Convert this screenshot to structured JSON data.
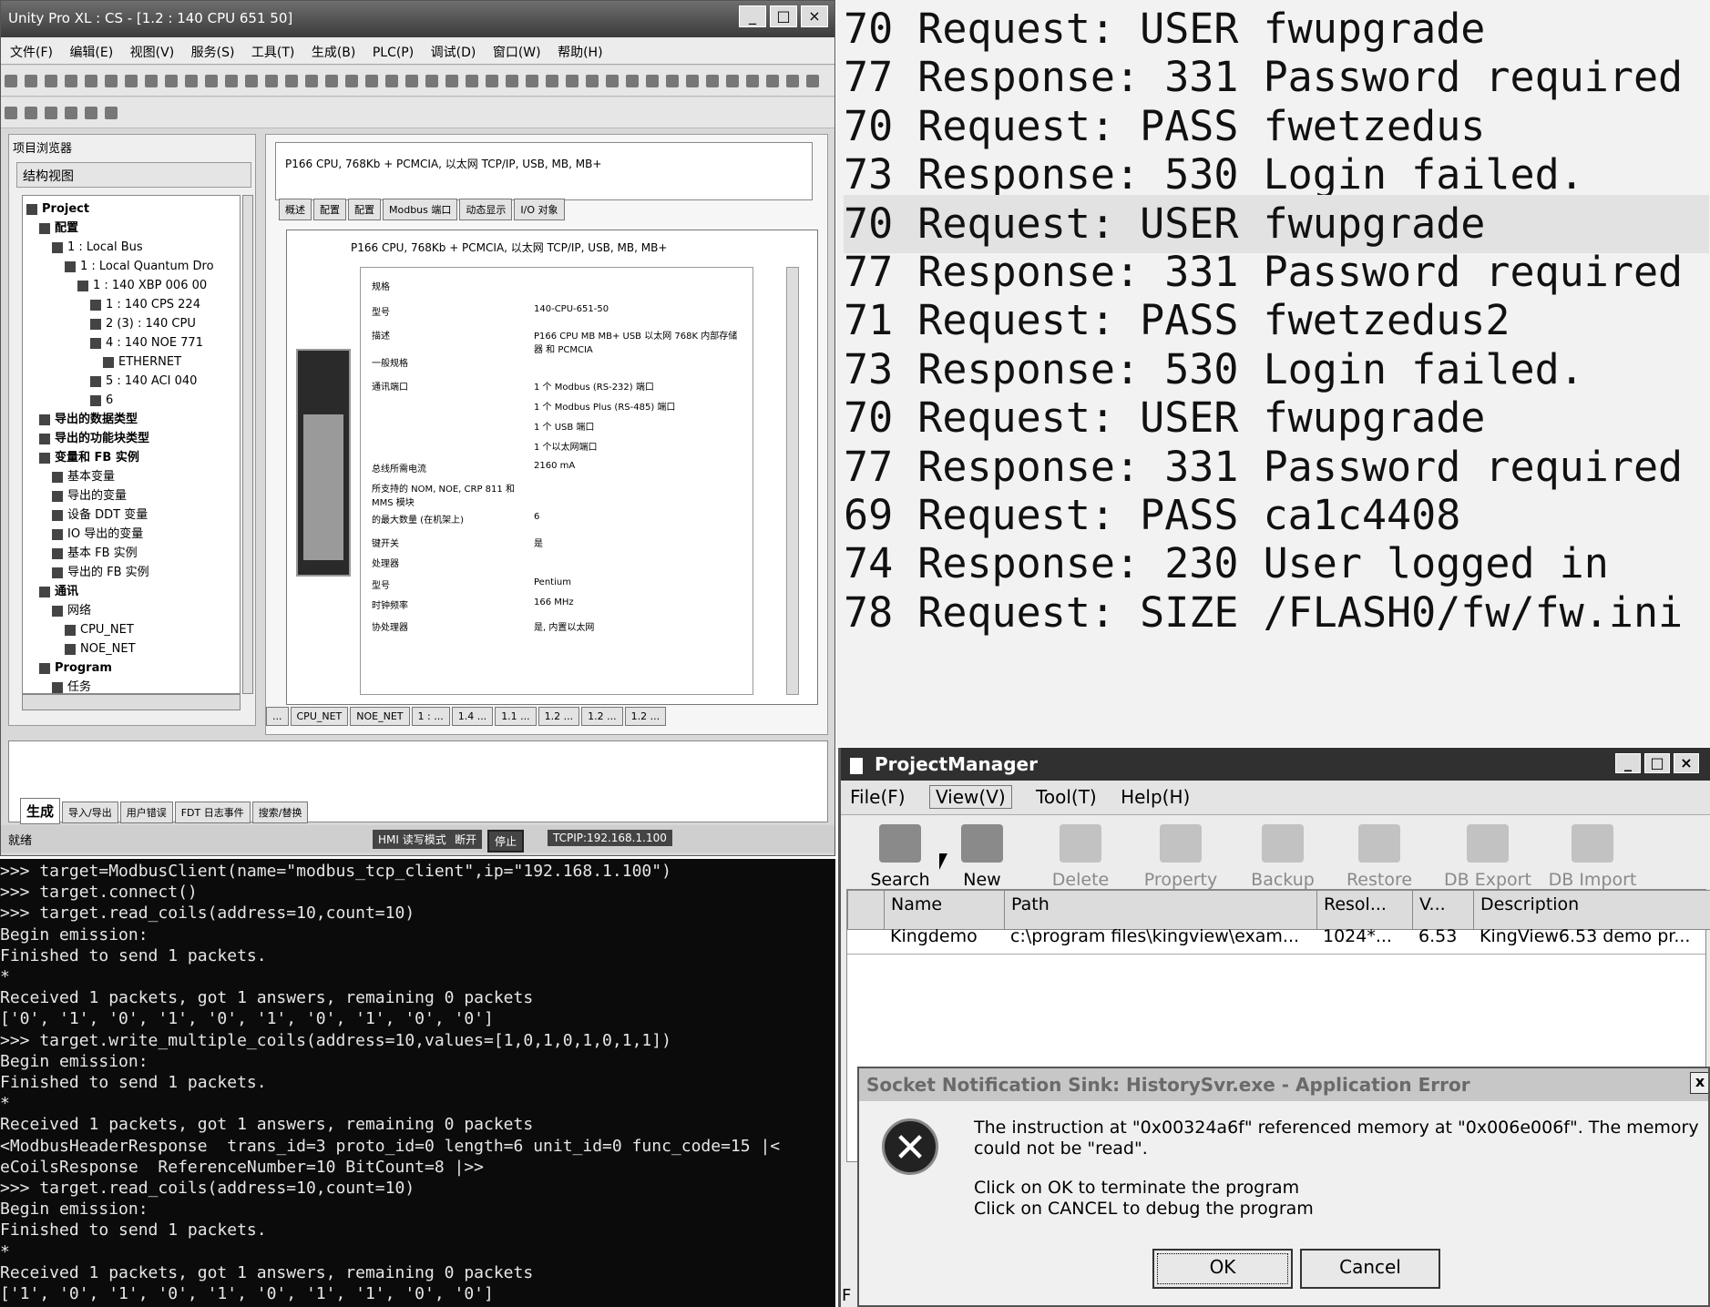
{
  "unity": {
    "title": "Unity Pro XL : CS - [1.2 : 140 CPU 651 50]",
    "window_controls": [
      "_",
      "□",
      "×"
    ],
    "menu": [
      "文件(F)",
      "编辑(E)",
      "视图(V)",
      "服务(S)",
      "工具(T)",
      "生成(B)",
      "PLC(P)",
      "调试(D)",
      "窗口(W)",
      "帮助(H)"
    ],
    "browser_title": "项目浏览器",
    "browser_view": "结构视图",
    "tree": [
      {
        "label": "Project",
        "indent": 0,
        "bold": true
      },
      {
        "label": "配置",
        "indent": 1,
        "bold": true
      },
      {
        "label": "1 : Local Bus",
        "indent": 2
      },
      {
        "label": "1 : Local Quantum Dro",
        "indent": 3
      },
      {
        "label": "1 : 140 XBP 006 00",
        "indent": 4
      },
      {
        "label": "1 : 140 CPS 224",
        "indent": 5
      },
      {
        "label": "2 (3) : 140 CPU",
        "indent": 5
      },
      {
        "label": "4 : 140 NOE 771",
        "indent": 5
      },
      {
        "label": "ETHERNET",
        "indent": 6
      },
      {
        "label": "5 : 140 ACI 040",
        "indent": 5
      },
      {
        "label": "6",
        "indent": 5
      },
      {
        "label": "导出的数据类型",
        "indent": 1,
        "bold": true
      },
      {
        "label": "导出的功能块类型",
        "indent": 1,
        "bold": true
      },
      {
        "label": "变量和 FB 实例",
        "indent": 1,
        "bold": true
      },
      {
        "label": "基本变量",
        "indent": 2
      },
      {
        "label": "导出的变量",
        "indent": 2
      },
      {
        "label": "设备 DDT 变量",
        "indent": 2
      },
      {
        "label": "IO 导出的变量",
        "indent": 2
      },
      {
        "label": "基本 FB 实例",
        "indent": 2
      },
      {
        "label": "导出的 FB 实例",
        "indent": 2
      },
      {
        "label": "通讯",
        "indent": 1,
        "bold": true
      },
      {
        "label": "网络",
        "indent": 2
      },
      {
        "label": "CPU_NET",
        "indent": 3
      },
      {
        "label": "NOE_NET",
        "indent": 3
      },
      {
        "label": "Program",
        "indent": 1,
        "bold": true
      },
      {
        "label": "任务",
        "indent": 2
      }
    ],
    "header_desc": "P166 CPU, 768Kb + PCMCIA, 以太网 TCP/IP, USB, MB, MB+",
    "tabs": [
      "概述",
      "配置",
      "配置",
      "Modbus 端口",
      "动态显示",
      "I/O 对象"
    ],
    "inner_title": "P166 CPU, 768Kb + PCMCIA, 以太网 TCP/IP, USB, MB, MB+",
    "props": [
      {
        "k": "规格",
        "v": ""
      },
      {
        "k": "型号",
        "v": "140-CPU-651-50"
      },
      {
        "k": "描述",
        "v": "P166 CPU MB MB+ USB 以太网 768K 内部存储器 和 PCMCIA"
      },
      {
        "k": "一般规格",
        "v": ""
      },
      {
        "k": "通讯端口",
        "v": "1 个 Modbus (RS-232) 端口"
      },
      {
        "k": "",
        "v": "1 个 Modbus Plus (RS-485) 端口"
      },
      {
        "k": "",
        "v": "1 个 USB 端口"
      },
      {
        "k": "",
        "v": "1 个以太网端口"
      },
      {
        "k": "总线所需电流",
        "v": "2160 mA"
      },
      {
        "k": "所支持的 NOM, NOE, CRP 811 和 MMS 模块",
        "v": ""
      },
      {
        "k": "的最大数量 (在机架上)",
        "v": "6"
      },
      {
        "k": "键开关",
        "v": "是"
      },
      {
        "k": "处理器",
        "v": ""
      },
      {
        "k": "型号",
        "v": "Pentium"
      },
      {
        "k": "时钟频率",
        "v": "166 MHz"
      },
      {
        "k": "协处理器",
        "v": "是, 内置以太网"
      }
    ],
    "bottom_tabs": [
      "...",
      "CPU_NET",
      "NOE_NET",
      "1 : ...",
      "1.4 ...",
      "1.1 ...",
      "1.2 ...",
      "1.2 ...",
      "1.2 ..."
    ],
    "output_tabs": [
      "生成",
      "导入/导出",
      "用户错误",
      "FDT 日志事件",
      "搜索/替换"
    ],
    "status": {
      "left": "就绪",
      "mode": "HMI 读写模式",
      "state1": "断开",
      "state2": "停止",
      "conn": "TCPIP:192.168.1.100"
    }
  },
  "ftp_log": [
    {
      "text": "70 Request: USER fwupgrade",
      "hl": false
    },
    {
      "text": "77 Response: 331 Password required",
      "hl": false
    },
    {
      "text": "70 Request: PASS fwetzedus",
      "hl": false
    },
    {
      "text": "73 Response: 530 Login failed.",
      "hl": false
    },
    {
      "text": "70 Request: USER fwupgrade",
      "hl": true
    },
    {
      "text": "77 Response: 331 Password required",
      "hl": false
    },
    {
      "text": "71 Request: PASS fwetzedus2",
      "hl": false
    },
    {
      "text": "73 Response: 530 Login failed.",
      "hl": false
    },
    {
      "text": "70 Request: USER fwupgrade",
      "hl": false
    },
    {
      "text": "77 Response: 331 Password required",
      "hl": false
    },
    {
      "text": "69 Request: PASS ca1c4408",
      "hl": false
    },
    {
      "text": "74 Response: 230 User logged in",
      "hl": false
    },
    {
      "text": "78 Request: SIZE /FLASH0/fw/fw.ini",
      "hl": false
    }
  ],
  "terminal": [
    ">>> target=ModbusClient(name=\"modbus_tcp_client\",ip=\"192.168.1.100\")",
    ">>> target.connect()",
    ">>> target.read_coils(address=10,count=10)",
    "Begin emission:",
    "Finished to send 1 packets.",
    "*",
    "Received 1 packets, got 1 answers, remaining 0 packets",
    "['0', '1', '0', '1', '0', '1', '0', '1', '0', '0']",
    ">>> target.write_multiple_coils(address=10,values=[1,0,1,0,1,0,1,1])",
    "Begin emission:",
    "Finished to send 1 packets.",
    "*",
    "Received 1 packets, got 1 answers, remaining 0 packets",
    "<ModbusHeaderResponse  trans_id=3 proto_id=0 length=6 unit_id=0 func_code=15 |<",
    "eCoilsResponse  ReferenceNumber=10 BitCount=8 |>>",
    ">>> target.read_coils(address=10,count=10)",
    "Begin emission:",
    "Finished to send 1 packets.",
    "*",
    "Received 1 packets, got 1 answers, remaining 0 packets",
    "['1', '0', '1', '0', '1', '0', '1', '1', '0', '0']"
  ],
  "pm": {
    "title": "ProjectManager",
    "menu": [
      "File(F)",
      "View(V)",
      "Tool(T)",
      "Help(H)"
    ],
    "tools": [
      {
        "label": "Search",
        "icon": "search-icon",
        "enabled": true
      },
      {
        "label": "New",
        "icon": "new-doc-icon",
        "enabled": true
      },
      {
        "label": "Delete",
        "icon": "delete-icon",
        "enabled": false
      },
      {
        "label": "Property",
        "icon": "property-icon",
        "enabled": false
      },
      {
        "label": "Backup",
        "icon": "backup-icon",
        "enabled": false
      },
      {
        "label": "Restore",
        "icon": "restore-icon",
        "enabled": false
      },
      {
        "label": "DB Export",
        "icon": "db-export-icon",
        "enabled": false
      },
      {
        "label": "DB Import",
        "icon": "db-import-icon",
        "enabled": false
      }
    ],
    "columns": [
      "Name",
      "Path",
      "Resol...",
      "V...",
      "Description"
    ],
    "rows": [
      [
        "Kingdemo",
        "c:\\program files\\kingview\\exam...",
        "1024*...",
        "6.53",
        "KingView6.53 demo pr..."
      ]
    ]
  },
  "error_dialog": {
    "title": "Socket Notification Sink: HistorySvr.exe - Application Error",
    "message1": "The instruction at \"0x00324a6f\" referenced memory at \"0x006e006f\". The memory could not be \"read\".",
    "message2": "Click on OK to terminate the program",
    "message3": "Click on CANCEL to debug the program",
    "ok": "OK",
    "cancel": "Cancel",
    "close": "x",
    "side_letter": "F"
  }
}
